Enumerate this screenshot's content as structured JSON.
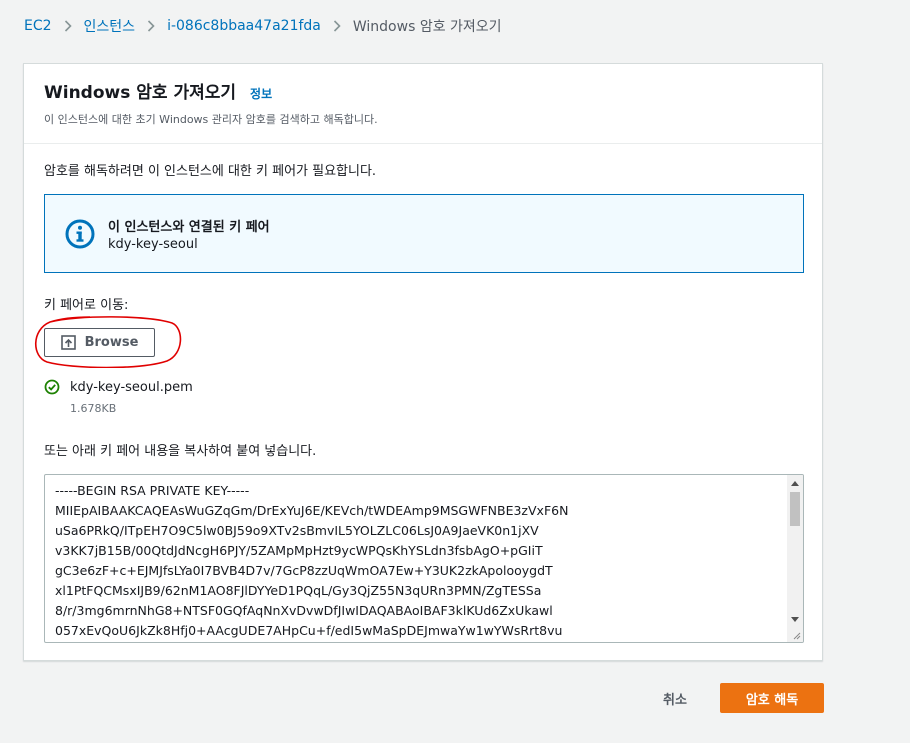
{
  "breadcrumb": {
    "items": [
      "EC2",
      "인스턴스",
      "i-086c8bbaa47a21fda"
    ],
    "current": "Windows 암호 가져오기"
  },
  "panel": {
    "title": "Windows 암호 가져오기",
    "info_link": "정보",
    "description": "이 인스턴스에 대한 초기 Windows 관리자 암호를 검색하고 해독합니다."
  },
  "body": {
    "need_key_text": "암호를 해독하려면 이 인스턴스에 대한 키 페어가 필요합니다.",
    "info_box": {
      "title": "이 인스턴스와 연결된 키 페어",
      "value": "kdy-key-seoul"
    },
    "navigate_label": "키 페어로 이동:",
    "browse_label": "Browse",
    "file": {
      "name": "kdy-key-seoul.pem",
      "size": "1.678KB"
    },
    "paste_label": "또는 아래 키 페어 내용을 복사하여 붙여 넣습니다.",
    "key_content": "-----BEGIN RSA PRIVATE KEY-----\nMIIEpAIBAAKCAQEAsWuGZqGm/DrExYuJ6E/KEVch/tWDEAmp9MSGWFNBE3zVxF6N\nuSa6PRkQ/ITpEH7O9C5lw0BJ59o9XTv2sBmvIL5YOLZLC06LsJ0A9JaeVK0n1jXV\nv3KK7jB15B/00QtdJdNcgH6PJY/5ZAMpMpHzt9ycWPQsKhYSLdn3fsbAgO+pGIiT\ngC3e6zF+c+EJMJfsLYa0I7BVB4D7v/7GcP8zzUqWmOA7Ew+Y3UK2zkApolooygdT\nxl1PtFQCMsxIJB9/62nM1AO8FJlDYYeD1PQqL/Gy3QjZ55N3qURn3PMN/ZgTESSa\n8/r/3mg6mrnNhG8+NTSF0GQfAqNnXvDvwDfJIwIDAQABAoIBAF3klKUd6ZxUkawl\n057xEvQoU6JkZk8Hfj0+AAcgUDE7AHpCu+f/edI5wMaSpDEJmwaYw1wYWsRrt8vu"
  },
  "footer": {
    "cancel_label": "취소",
    "decrypt_label": "암호 해독"
  },
  "colors": {
    "link": "#0073bb",
    "primary": "#ec7211",
    "success": "#1d8102",
    "annotation": "#e00000"
  }
}
